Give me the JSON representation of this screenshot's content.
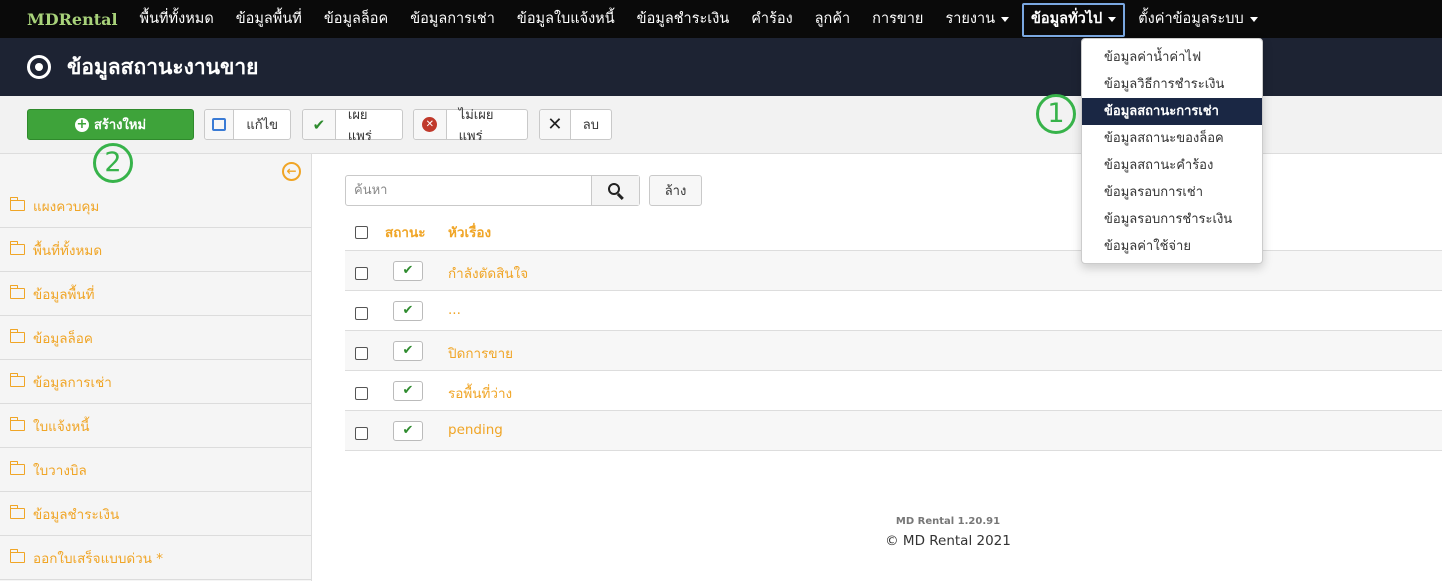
{
  "navbar": {
    "brand": "MDRental",
    "items": [
      {
        "label": "พื้นที่ทั้งหมด"
      },
      {
        "label": "ข้อมูลพื้นที่"
      },
      {
        "label": "ข้อมูลล็อค"
      },
      {
        "label": "ข้อมูลการเช่า"
      },
      {
        "label": "ข้อมูลใบแจ้งหนี้"
      },
      {
        "label": "ข้อมูลชำระเงิน"
      },
      {
        "label": "คำร้อง"
      },
      {
        "label": "ลูกค้า"
      },
      {
        "label": "การขาย"
      },
      {
        "label": "รายงาน"
      },
      {
        "label": "ข้อมูลทั่วไป"
      },
      {
        "label": "ตั้งค่าข้อมูลระบบ"
      }
    ]
  },
  "header": {
    "title": "ข้อมูลสถานะงานขาย",
    "icon": "target-icon"
  },
  "toolbar": {
    "new_label": "สร้างใหม่",
    "edit_label": "แก้ไข",
    "publish_label": "เผยแพร่",
    "unpublish_label": "ไม่เผยแพร่",
    "delete_label": "ลบ"
  },
  "callouts": {
    "one": "1",
    "two": "2"
  },
  "sidebar": {
    "items": [
      {
        "label": "แผงควบคุม"
      },
      {
        "label": "พื้นที่ทั้งหมด"
      },
      {
        "label": "ข้อมูลพื้นที่"
      },
      {
        "label": "ข้อมูลล็อค"
      },
      {
        "label": "ข้อมูลการเช่า"
      },
      {
        "label": "ใบแจ้งหนี้"
      },
      {
        "label": "ใบวางบิล"
      },
      {
        "label": "ข้อมูลชำระเงิน"
      },
      {
        "label": "ออกใบเสร็จแบบด่วน *"
      }
    ]
  },
  "search": {
    "placeholder": "ค้นหา",
    "value": "",
    "clear_label": "ล้าง"
  },
  "table": {
    "columns": {
      "status": "สถานะ",
      "title": "หัวเรื่อง"
    },
    "rows": [
      {
        "title": "กำลังตัดสินใจ",
        "status": "published"
      },
      {
        "title": "...",
        "status": "published"
      },
      {
        "title": "ปิดการขาย",
        "status": "published"
      },
      {
        "title": "รอพื้นที่ว่าง",
        "status": "published"
      },
      {
        "title": "pending",
        "status": "published"
      }
    ]
  },
  "footer": {
    "version": "MD Rental 1.20.91",
    "copyright": "© MD Rental 2021"
  },
  "dropdown": {
    "items": [
      {
        "label": "ข้อมูลค่าน้ำค่าไฟ"
      },
      {
        "label": "ข้อมูลวิธีการชำระเงิน"
      },
      {
        "label": "ข้อมูลสถานะการเช่า"
      },
      {
        "label": "ข้อมูลสถานะของล็อค"
      },
      {
        "label": "ข้อมูลสถานะคำร้อง"
      },
      {
        "label": "ข้อมูลรอบการเช่า"
      },
      {
        "label": "ข้อมูลรอบการชำระเงิน"
      },
      {
        "label": "ข้อมูลค่าใช้จ่าย"
      }
    ],
    "active_index": 2
  },
  "colors": {
    "brand": "#a8d27a",
    "accent": "#f0a526",
    "success": "#3ea33a",
    "callout": "#37b34a",
    "header_bg": "#1d2333"
  }
}
